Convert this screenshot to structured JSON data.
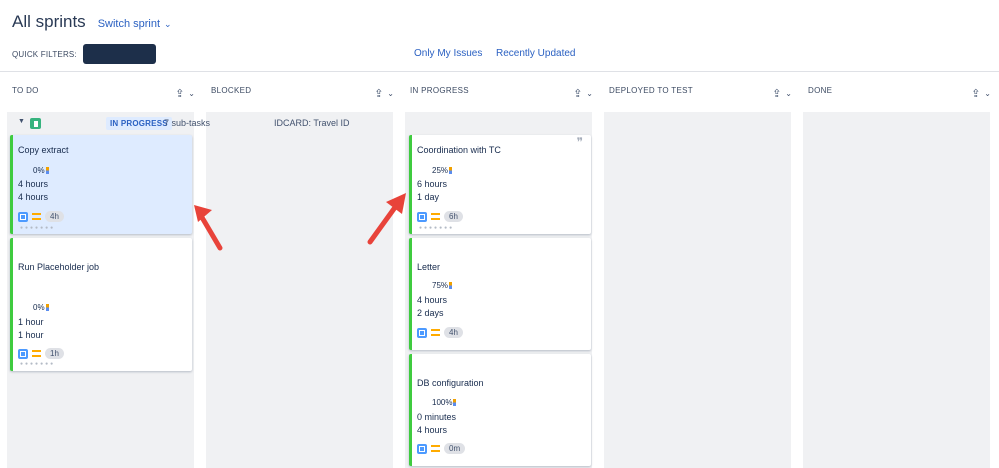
{
  "header": {
    "title": "All sprints",
    "switch_sprint": "Switch sprint"
  },
  "filters": {
    "label": "QUICK FILTERS:",
    "links": [
      "Only My Issues",
      "Recently Updated"
    ]
  },
  "columns": [
    {
      "title": "TO DO"
    },
    {
      "title": "BLOCKED"
    },
    {
      "title": "IN PROGRESS"
    },
    {
      "title": "DEPLOYED TO TEST"
    },
    {
      "title": "DONE"
    }
  ],
  "swimlane": {
    "status": "IN PROGRESS",
    "subtasks": "7 sub-tasks",
    "summary": "IDCARD: Travel ID"
  },
  "cards": {
    "todo_1": {
      "summary": "Copy extract",
      "progress": "0%",
      "remaining": "4 hours",
      "original": "4 hours",
      "estimate": "4h"
    },
    "todo_2": {
      "summary": "Run Placeholder job",
      "progress": "0%",
      "remaining": "1 hour",
      "original": "1 hour",
      "estimate": "1h"
    },
    "ip_1": {
      "summary": "Coordination with TC",
      "progress": "25%",
      "remaining": "6 hours",
      "original": "1 day",
      "estimate": "6h"
    },
    "ip_2": {
      "summary": "Letter",
      "progress": "75%",
      "remaining": "4 hours",
      "original": "2 days",
      "estimate": "4h"
    },
    "ip_3": {
      "summary": "DB configuration",
      "progress": "100%",
      "remaining": "0 minutes",
      "original": "4 hours",
      "estimate": "0m"
    }
  },
  "colors": {
    "accent_link": "#2b61c2",
    "card_border": "#3fcb3f",
    "selected_card": "#deebff",
    "arrow": "#e8433a"
  }
}
